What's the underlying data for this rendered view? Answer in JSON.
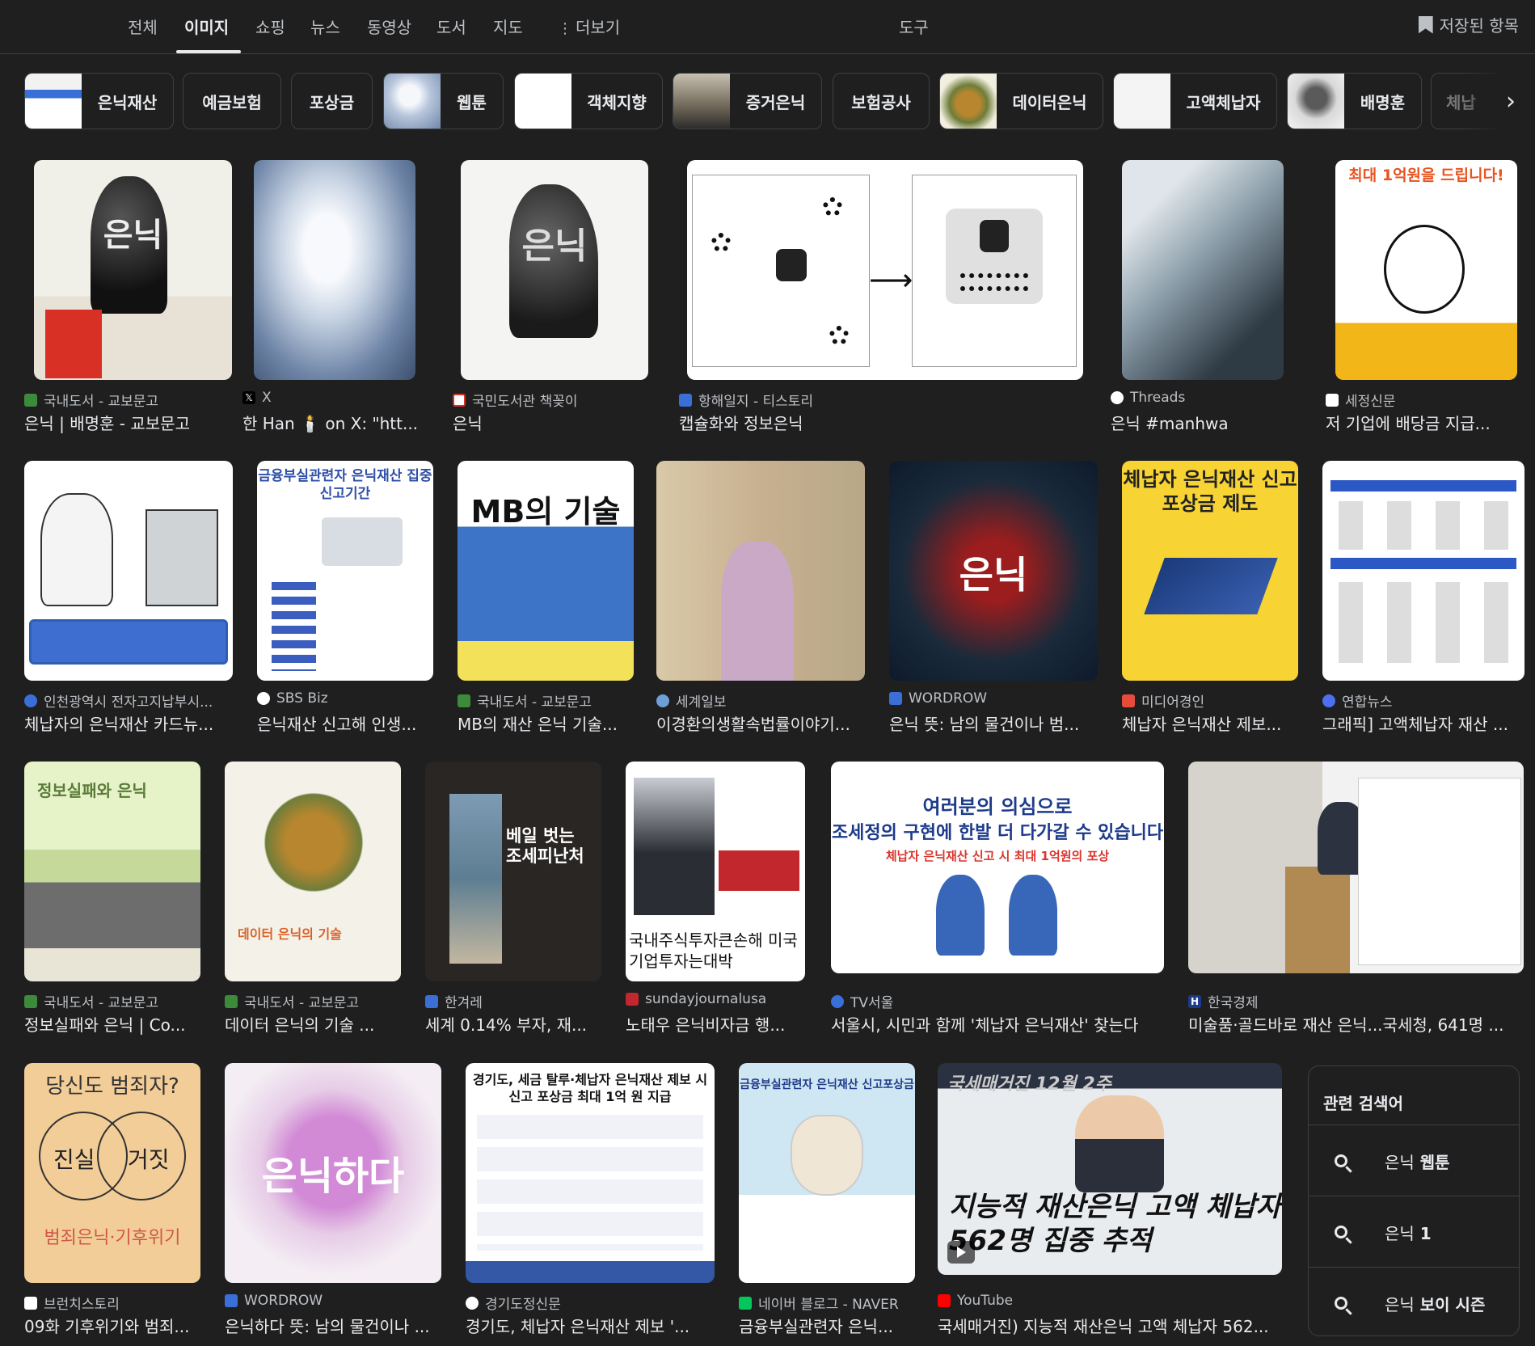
{
  "tabs": [
    "전체",
    "이미지",
    "쇼핑",
    "뉴스",
    "동영상",
    "도서",
    "지도"
  ],
  "more_label": "더보기",
  "tools_label": "도구",
  "saved_label": "저장된 항목",
  "chips": [
    "은닉재산",
    "예금보험",
    "포상금",
    "웹툰",
    "객체지향",
    "증거은닉",
    "보험공사",
    "데이터은닉",
    "고액체납자",
    "배명훈",
    "체납"
  ],
  "results": [
    {
      "source": "국내도서 - 교보문고",
      "title": "은닉 | 배명훈 - 교보문고"
    },
    {
      "source": "X",
      "title": "한 Han 🕯️ on X: \"htt..."
    },
    {
      "source": "국민도서관 책꽂이",
      "title": "은닉"
    },
    {
      "source": "항해일지 - 티스토리",
      "title": "캡슐화와 정보은닉"
    },
    {
      "source": "Threads",
      "title": "은닉 #manhwa"
    },
    {
      "source": "세정신문",
      "title": "저 기업에 배당금 지급..."
    },
    {
      "source": "인천광역시 전자고지납부시...",
      "title": "체납자의 은닉재산 카드뉴..."
    },
    {
      "source": "SBS Biz",
      "title": "은닉재산 신고해 인생..."
    },
    {
      "source": "국내도서 - 교보문고",
      "title": "MB의 재산 은닉 기술..."
    },
    {
      "source": "세계일보",
      "title": "이경환의생활속법률이야기..."
    },
    {
      "source": "WORDROW",
      "title": "은닉 뜻: 남의 물건이나 범..."
    },
    {
      "source": "미디어경인",
      "title": "체납자 은닉재산 제보..."
    },
    {
      "source": "연합뉴스",
      "title": "그래픽] 고액체납자 재산 ..."
    },
    {
      "source": "국내도서 - 교보문고",
      "title": "정보실패와 은닉 | Co..."
    },
    {
      "source": "국내도서 - 교보문고",
      "title": "데이터 은닉의 기술 ..."
    },
    {
      "source": "한겨레",
      "title": "세계 0.14% 부자, 재..."
    },
    {
      "source": "sundayjournalusa",
      "title": "노태우 은닉비자금 행..."
    },
    {
      "source": "TV서울",
      "title": "서울시, 시민과 함께 '체납자 은닉재산' 찾는다"
    },
    {
      "source": "한국경제",
      "title": "미술품·골드바로 재산 은닉...국세청, 641명 ..."
    },
    {
      "source": "브런치스토리",
      "title": "09화 기후위기와 범죄..."
    },
    {
      "source": "WORDROW",
      "title": "은닉하다 뜻: 남의 물건이나 ..."
    },
    {
      "source": "경기도정신문",
      "title": "경기도, 체납자 은닉재산 제보 '..."
    },
    {
      "source": "네이버 블로그 - NAVER",
      "title": "금융부실관련자 은닉..."
    },
    {
      "source": "YouTube",
      "title": "국세매거진) 지능적 재산은닉 고액 체납자 562..."
    }
  ],
  "image_text": {
    "book1": "은닉",
    "poster1": "최대 1억원을 드립니다!",
    "info1": "금융부실관련자 은닉재산 집중신고기간",
    "mb": "MB의 기술",
    "wordrow": "은닉",
    "poster2": "체납자 은닉재산 신고 포상금 제도",
    "book3": "정보실패와 은닉",
    "book4": "데이터 은닉의 기술",
    "hani": "베일 벗는 조세피난처",
    "sunday": "국내주식투자큰손해 미국기업투자는대박",
    "tvseoul1": "여러분의 의심으로",
    "tvseoul2": "조세정의 구현에 한발 더 다가갈 수 있습니다",
    "tvseoul3": "체납자 은닉재산 신고 시 최대 1억원의 포상",
    "brunch_top": "당신도 범죄자?",
    "brunch_l": "진실",
    "brunch_r": "거짓",
    "brunch_bot": "범죄은닉·기후위기",
    "wordrow2": "은닉하다",
    "gyeonggi": "경기도, 세금 탈루·체납자 은닉재산 제보 시 신고 포상금 최대 1억 원 지급",
    "naver": "금융부실관련자 은닉재산 신고포상금",
    "yt_tag": "국세매거진 12월 2주",
    "yt_main1": "지능적 재산은닉 고액 체납자",
    "yt_main2": "562명 집중 추적"
  },
  "related": {
    "title": "관련 검색어",
    "items": [
      {
        "prefix": "은닉",
        "bold": "웹툰"
      },
      {
        "prefix": "은닉",
        "bold": "1"
      },
      {
        "prefix": "은닉",
        "bold": "보이 시즌"
      }
    ]
  }
}
